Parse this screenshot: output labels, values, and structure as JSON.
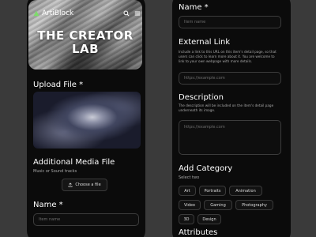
{
  "brand": {
    "name": "ArtiBlock",
    "accent": "#7ddc6a"
  },
  "hero": {
    "title_line1": "THE CREATOR",
    "title_line2": "LAB"
  },
  "icons": {
    "search": "search-icon",
    "menu": "menu-icon",
    "upload": "upload-icon",
    "logo": "triangle-logo-icon"
  },
  "left": {
    "upload_label": "Upload File *",
    "additional_label": "Additional Media File",
    "additional_sub": "Music or Sound tracks",
    "choose_file": "Choose a file",
    "name_label": "Name *",
    "name_placeholder": "Item name"
  },
  "right": {
    "name_label": "Name *",
    "name_placeholder": "Item name",
    "external_label": "External Link",
    "external_help": "Include a link to this URL on this item's detail page, so that users can click to learn more about it. You are welcome to link to your own webpage with more details.",
    "external_placeholder": "https://example.com",
    "description_label": "Description",
    "description_help": "The description will be included on the item's detail page underneath its image.",
    "description_placeholder": "https://example.com",
    "category_label": "Add Category",
    "category_sub": "Select two",
    "categories": [
      "Art",
      "Portraits",
      "Animation",
      "Video",
      "Gaming",
      "Photography",
      "3D",
      "Design"
    ],
    "next_label": "Attributes"
  }
}
